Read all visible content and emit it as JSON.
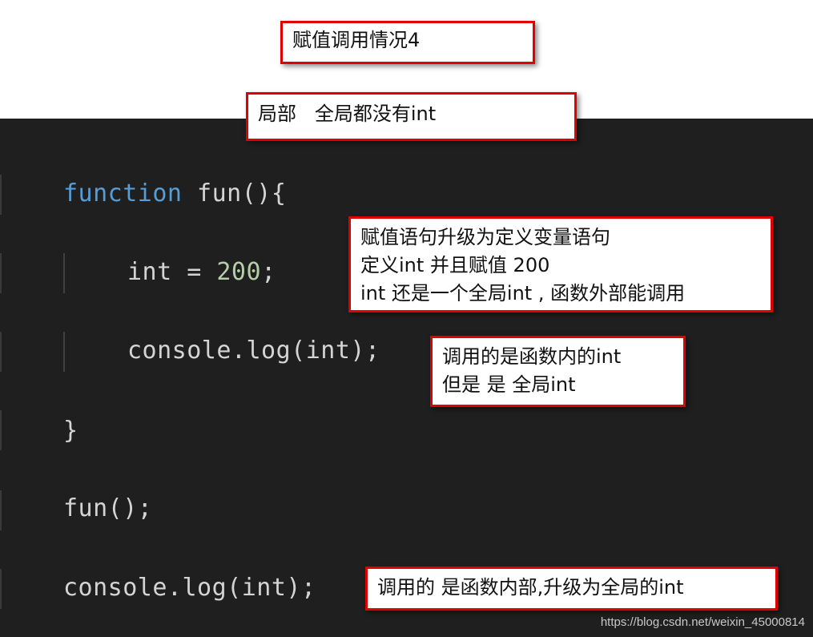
{
  "title_box": {
    "text": "赋值调用情况4"
  },
  "subtitle_box": {
    "text": "局部   全局都没有int"
  },
  "code": {
    "line1": {
      "keyword": "function",
      "rest": " fun(){"
    },
    "line2": {
      "ident": "int = ",
      "number": "200",
      "end": ";"
    },
    "line3": {
      "text": "console.log(int);"
    },
    "line4": {
      "text": "}"
    },
    "line5": {
      "text": "fun();"
    },
    "line6": {
      "text": "console.log(int);"
    }
  },
  "annotations": {
    "assign_upgrade": {
      "lines": [
        "赋值语句升级为定义变量语句",
        "定义int 并且赋值 200",
        "int 还是一个全局int , 函数外部能调用"
      ]
    },
    "inner_log": {
      "lines": [
        "调用的是函数内的int",
        "但是 是 全局int"
      ]
    },
    "outer_log": {
      "lines": [
        "调用的 是函数内部,升级为全局的int"
      ]
    }
  },
  "colors": {
    "editor_bg": "#1f1f1f",
    "keyword": "#569cd6",
    "number": "#b5cea8",
    "default_text": "#d4d4d4",
    "note_border": "#e00000"
  },
  "watermark": "https://blog.csdn.net/weixin_45000814"
}
